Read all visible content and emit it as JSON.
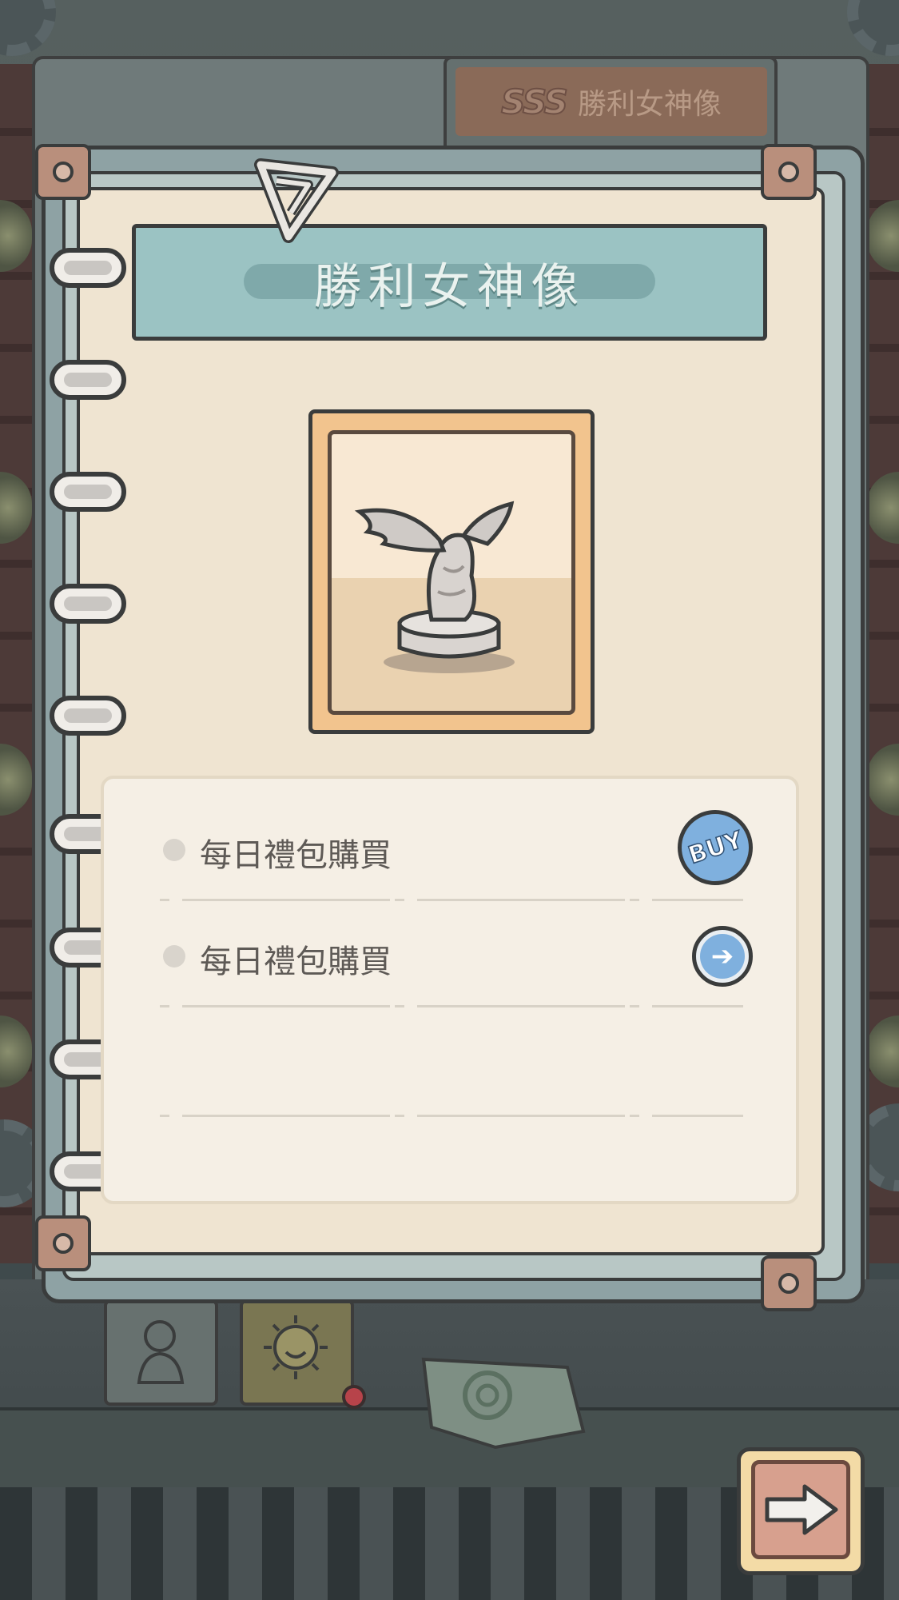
{
  "header_tab": {
    "rank_badge": "SSS",
    "title": "勝利女神像"
  },
  "card": {
    "title": "勝利女神像",
    "image_icon": "winged-victory-statue-icon"
  },
  "list": {
    "items": [
      {
        "label": "每日禮包購買",
        "action": "buy",
        "action_label": "BUY"
      },
      {
        "label": "每日禮包購買",
        "action": "go",
        "action_icon": "arrow-right-icon"
      }
    ]
  },
  "colors": {
    "banner": "#9bc3c3",
    "page": "#efe4d1",
    "card_frame": "#f2c48e",
    "buy_button": "#7fb0de",
    "next_button": "#f3dba6",
    "notification_dot": "#b7434a"
  }
}
